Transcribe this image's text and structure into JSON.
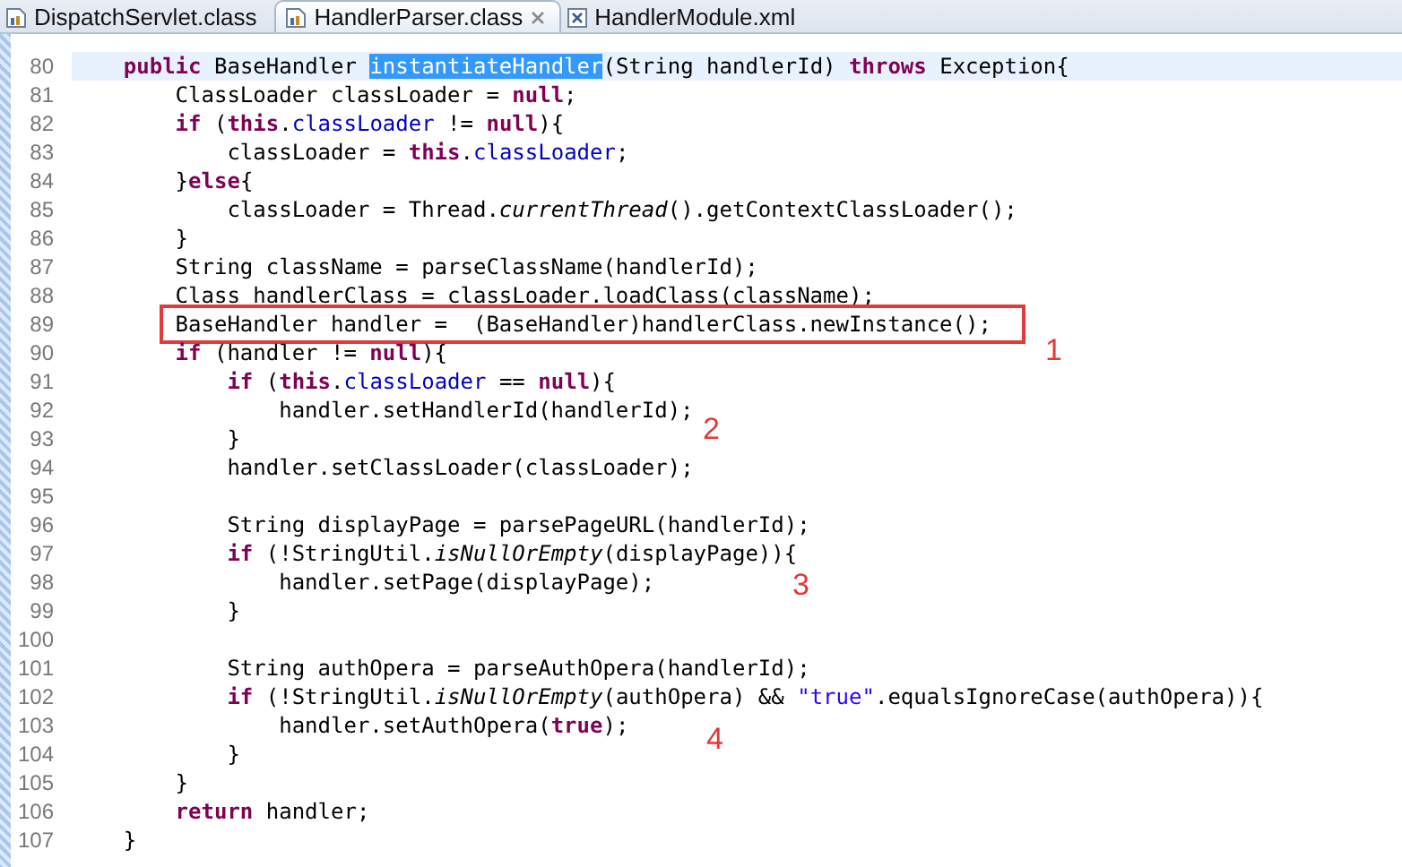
{
  "tabs": [
    {
      "label": "DispatchServlet.class",
      "kind": "class",
      "selected": false
    },
    {
      "label": "HandlerParser.class",
      "kind": "class",
      "selected": true
    },
    {
      "label": "HandlerModule.xml",
      "kind": "xml",
      "selected": false
    }
  ],
  "lines": [
    {
      "number": "80",
      "current": true,
      "tokens": [
        {
          "kind": "keyword",
          "text": "    public"
        },
        {
          "kind": "plain",
          "text": " BaseHandler "
        },
        {
          "kind": "selection",
          "text": "instantiateHandler"
        },
        {
          "kind": "plain",
          "text": "(String handlerId) "
        },
        {
          "kind": "keyword",
          "text": "throws"
        },
        {
          "kind": "plain",
          "text": " Exception{"
        }
      ]
    },
    {
      "number": "81",
      "current": false,
      "tokens": [
        {
          "kind": "plain",
          "text": "        ClassLoader classLoader = "
        },
        {
          "kind": "keyword",
          "text": "null"
        },
        {
          "kind": "plain",
          "text": ";"
        }
      ]
    },
    {
      "number": "82",
      "current": false,
      "tokens": [
        {
          "kind": "keyword",
          "text": "        if"
        },
        {
          "kind": "plain",
          "text": " ("
        },
        {
          "kind": "keyword",
          "text": "this"
        },
        {
          "kind": "plain",
          "text": "."
        },
        {
          "kind": "field",
          "text": "classLoader"
        },
        {
          "kind": "plain",
          "text": " != "
        },
        {
          "kind": "keyword",
          "text": "null"
        },
        {
          "kind": "plain",
          "text": "){"
        }
      ]
    },
    {
      "number": "83",
      "current": false,
      "tokens": [
        {
          "kind": "plain",
          "text": "            classLoader = "
        },
        {
          "kind": "keyword",
          "text": "this"
        },
        {
          "kind": "plain",
          "text": "."
        },
        {
          "kind": "field",
          "text": "classLoader"
        },
        {
          "kind": "plain",
          "text": ";"
        }
      ]
    },
    {
      "number": "84",
      "current": false,
      "tokens": [
        {
          "kind": "plain",
          "text": "        }"
        },
        {
          "kind": "keyword",
          "text": "else"
        },
        {
          "kind": "plain",
          "text": "{"
        }
      ]
    },
    {
      "number": "85",
      "current": false,
      "tokens": [
        {
          "kind": "plain",
          "text": "            classLoader = Thread."
        },
        {
          "kind": "static",
          "text": "currentThread"
        },
        {
          "kind": "plain",
          "text": "().getContextClassLoader();"
        }
      ]
    },
    {
      "number": "86",
      "current": false,
      "tokens": [
        {
          "kind": "plain",
          "text": "        }"
        }
      ]
    },
    {
      "number": "87",
      "current": false,
      "tokens": [
        {
          "kind": "plain",
          "text": "        String className = parseClassName(handlerId);"
        }
      ]
    },
    {
      "number": "88",
      "current": false,
      "tokens": [
        {
          "kind": "plain",
          "text": "        Class handlerClass = classLoader.loadClass(className);"
        }
      ]
    },
    {
      "number": "89",
      "current": false,
      "boxed": true,
      "tokens": [
        {
          "kind": "plain",
          "text": "        BaseHandler handler =  (BaseHandler)handlerClass.newInstance();"
        }
      ]
    },
    {
      "number": "90",
      "current": false,
      "tokens": [
        {
          "kind": "keyword",
          "text": "        if"
        },
        {
          "kind": "plain",
          "text": " (handler != "
        },
        {
          "kind": "keyword",
          "text": "null"
        },
        {
          "kind": "plain",
          "text": "){"
        }
      ]
    },
    {
      "number": "91",
      "current": false,
      "tokens": [
        {
          "kind": "keyword",
          "text": "            if"
        },
        {
          "kind": "plain",
          "text": " ("
        },
        {
          "kind": "keyword",
          "text": "this"
        },
        {
          "kind": "plain",
          "text": "."
        },
        {
          "kind": "field",
          "text": "classLoader"
        },
        {
          "kind": "plain",
          "text": " == "
        },
        {
          "kind": "keyword",
          "text": "null"
        },
        {
          "kind": "plain",
          "text": "){"
        }
      ]
    },
    {
      "number": "92",
      "current": false,
      "tokens": [
        {
          "kind": "plain",
          "text": "                handler.setHandlerId(handlerId);"
        }
      ]
    },
    {
      "number": "93",
      "current": false,
      "tokens": [
        {
          "kind": "plain",
          "text": "            }"
        }
      ]
    },
    {
      "number": "94",
      "current": false,
      "tokens": [
        {
          "kind": "plain",
          "text": "            handler.setClassLoader(classLoader);"
        }
      ]
    },
    {
      "number": "95",
      "current": false
    },
    {
      "number": "96",
      "current": false,
      "tokens": [
        {
          "kind": "plain",
          "text": "            String displayPage = parsePageURL(handlerId);"
        }
      ]
    },
    {
      "number": "97",
      "current": false,
      "tokens": [
        {
          "kind": "keyword",
          "text": "            if"
        },
        {
          "kind": "plain",
          "text": " (!StringUtil."
        },
        {
          "kind": "static",
          "text": "isNullOrEmpty"
        },
        {
          "kind": "plain",
          "text": "(displayPage)){"
        }
      ]
    },
    {
      "number": "98",
      "current": false,
      "tokens": [
        {
          "kind": "plain",
          "text": "                handler.setPage(displayPage);"
        }
      ]
    },
    {
      "number": "99",
      "current": false,
      "tokens": [
        {
          "kind": "plain",
          "text": "            }"
        }
      ]
    },
    {
      "number": "100",
      "current": false
    },
    {
      "number": "101",
      "current": false,
      "tokens": [
        {
          "kind": "plain",
          "text": "            String authOpera = parseAuthOpera(handlerId);"
        }
      ]
    },
    {
      "number": "102",
      "current": false,
      "tokens": [
        {
          "kind": "keyword",
          "text": "            if"
        },
        {
          "kind": "plain",
          "text": " (!StringUtil."
        },
        {
          "kind": "static",
          "text": "isNullOrEmpty"
        },
        {
          "kind": "plain",
          "text": "(authOpera) && "
        },
        {
          "kind": "string",
          "text": "\"true\""
        },
        {
          "kind": "plain",
          "text": ".equalsIgnoreCase(authOpera)){"
        }
      ]
    },
    {
      "number": "103",
      "current": false,
      "tokens": [
        {
          "kind": "plain",
          "text": "                handler.setAuthOpera("
        },
        {
          "kind": "keyword",
          "text": "true"
        },
        {
          "kind": "plain",
          "text": ");"
        }
      ]
    },
    {
      "number": "104",
      "current": false,
      "tokens": [
        {
          "kind": "plain",
          "text": "            }"
        }
      ]
    },
    {
      "number": "105",
      "current": false,
      "tokens": [
        {
          "kind": "plain",
          "text": "        }"
        }
      ]
    },
    {
      "number": "106",
      "current": false,
      "tokens": [
        {
          "kind": "keyword",
          "text": "        return"
        },
        {
          "kind": "plain",
          "text": " handler;"
        }
      ]
    },
    {
      "number": "107",
      "current": false,
      "tokens": [
        {
          "kind": "plain",
          "text": "    }"
        }
      ]
    }
  ],
  "annotations": [
    {
      "kind": "number",
      "text": "1"
    },
    {
      "kind": "number",
      "text": "2"
    },
    {
      "kind": "number",
      "text": "3"
    },
    {
      "kind": "number",
      "text": "4"
    }
  ]
}
